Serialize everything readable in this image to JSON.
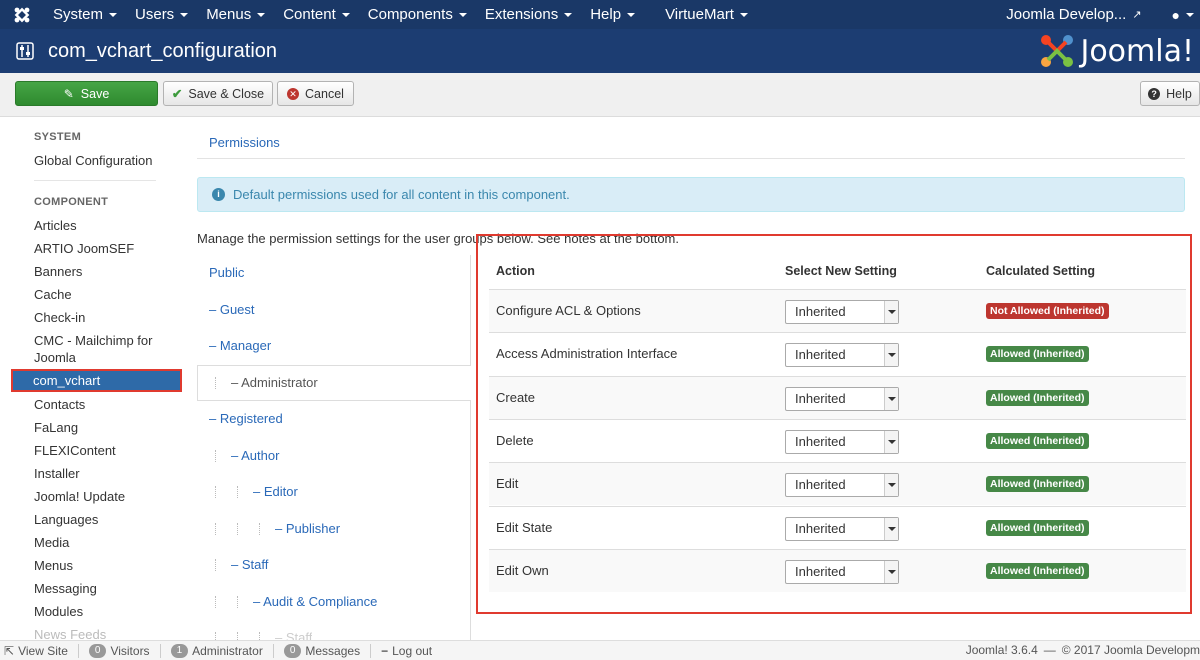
{
  "topnav": {
    "menu": [
      "System",
      "Users",
      "Menus",
      "Content",
      "Components",
      "Extensions",
      "Help"
    ],
    "virtuemart": "VirtueMart",
    "site_link": "Joomla Develop..."
  },
  "titlebar": {
    "title": "com_vchart_configuration",
    "brand": "Joomla!"
  },
  "toolbar": {
    "save": "Save",
    "save_close": "Save & Close",
    "cancel": "Cancel",
    "help": "Help"
  },
  "sidebar": {
    "system_header": "SYSTEM",
    "global_config": "Global Configuration",
    "component_header": "COMPONENT",
    "items": [
      "Articles",
      "ARTIO JoomSEF",
      "Banners",
      "Cache",
      "Check-in",
      "CMC - Mailchimp for Joomla",
      "com_vchart",
      "Contacts",
      "FaLang",
      "FLEXIContent",
      "Installer",
      "Joomla! Update",
      "Languages",
      "Media",
      "Menus",
      "Messaging",
      "Modules",
      "News Feeds"
    ]
  },
  "main": {
    "tab": "Permissions",
    "alert": "Default permissions used for all content in this component.",
    "intro": "Manage the permission settings for the user groups below. See notes at the bottom.",
    "groups": [
      "Public",
      "– Guest",
      "– Manager",
      "– Administrator",
      "– Registered",
      "– Author",
      "– Editor",
      "– Publisher",
      "– Staff",
      "– Audit & Compliance",
      "– Staff"
    ]
  },
  "perm_table": {
    "headers": {
      "action": "Action",
      "select": "Select New Setting",
      "calculated": "Calculated Setting"
    },
    "rows": [
      {
        "action": "Configure ACL & Options",
        "setting": "Inherited",
        "calculated": "Not Allowed (Inherited)",
        "status": "denied"
      },
      {
        "action": "Access Administration Interface",
        "setting": "Inherited",
        "calculated": "Allowed (Inherited)",
        "status": "allowed"
      },
      {
        "action": "Create",
        "setting": "Inherited",
        "calculated": "Allowed (Inherited)",
        "status": "allowed"
      },
      {
        "action": "Delete",
        "setting": "Inherited",
        "calculated": "Allowed (Inherited)",
        "status": "allowed"
      },
      {
        "action": "Edit",
        "setting": "Inherited",
        "calculated": "Allowed (Inherited)",
        "status": "allowed"
      },
      {
        "action": "Edit State",
        "setting": "Inherited",
        "calculated": "Allowed (Inherited)",
        "status": "allowed"
      },
      {
        "action": "Edit Own",
        "setting": "Inherited",
        "calculated": "Allowed (Inherited)",
        "status": "allowed"
      }
    ]
  },
  "statusbar": {
    "view_site": "View Site",
    "visitors_count": "0",
    "visitors": "Visitors",
    "admin_count": "1",
    "admin": "Administrator",
    "messages_count": "0",
    "messages": "Messages",
    "logout": "Log out",
    "version": "Joomla! 3.6.4",
    "copyright": "© 2017 Joomla Developm"
  },
  "colors": {
    "nav": "#1a3867",
    "title": "#1c3d72",
    "save_green": "#3d9b3d",
    "denied": "#bd362f",
    "allowed": "#468847",
    "highlight": "#e03a2f"
  }
}
